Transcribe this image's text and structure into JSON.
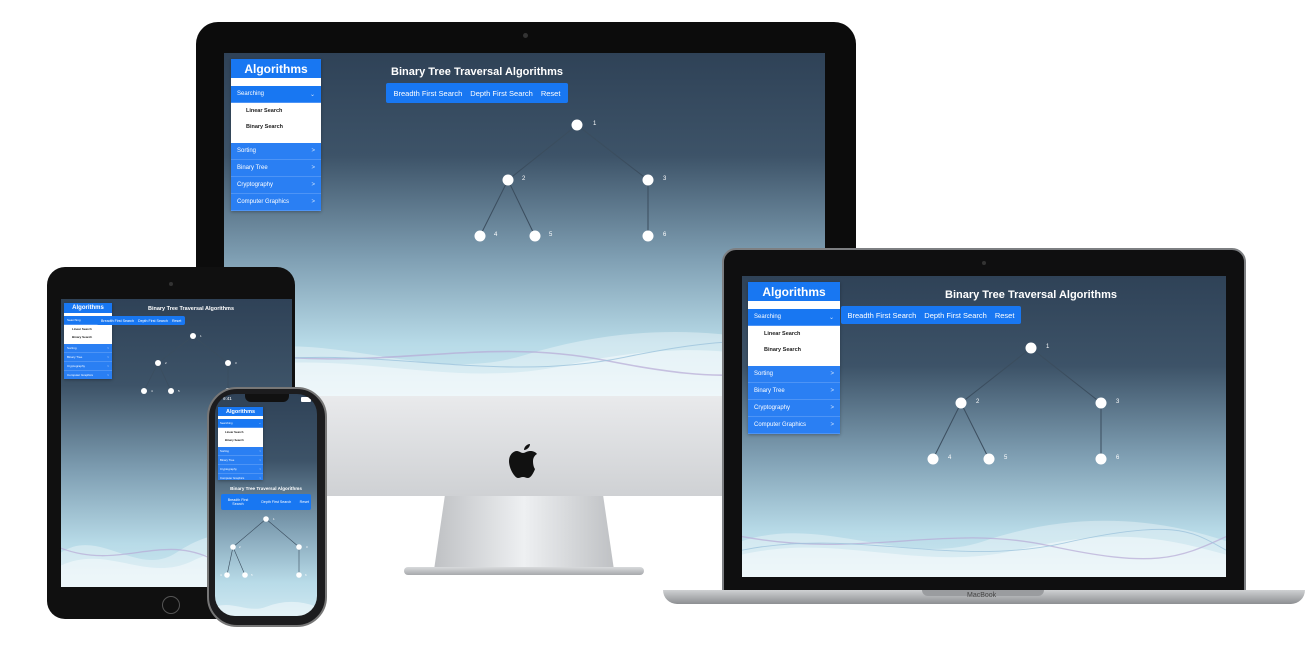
{
  "app": {
    "sidebar_title": "Algorithms",
    "categories": [
      {
        "label": "Searching",
        "chevron": "⌄",
        "open": true
      },
      {
        "label": "Sorting",
        "chevron": ">"
      },
      {
        "label": "Binary Tree",
        "chevron": ">"
      },
      {
        "label": "Cryptography",
        "chevron": ">"
      },
      {
        "label": "Computer Graphics",
        "chevron": ">"
      }
    ],
    "search_items": [
      "Linear Search",
      "Binary Search"
    ],
    "title": "Binary Tree Traversal Algorithms",
    "buttons": {
      "bfs": "Breadth First Search",
      "dfs": "Depth First Search",
      "reset": "Reset"
    },
    "phone_buttons": {
      "bfs": "Breadth First Search",
      "dfs": "Depth First Search",
      "reset": "Reset"
    },
    "tree_nodes": [
      "1",
      "2",
      "3",
      "4",
      "5",
      "6"
    ],
    "colors": {
      "accent": "#1877f2",
      "screen_top": "#2f4257",
      "screen_bottom": "#cfe8f1"
    }
  },
  "devices": {
    "phone_status_time": "9:41",
    "macbook_label": "MacBook"
  }
}
